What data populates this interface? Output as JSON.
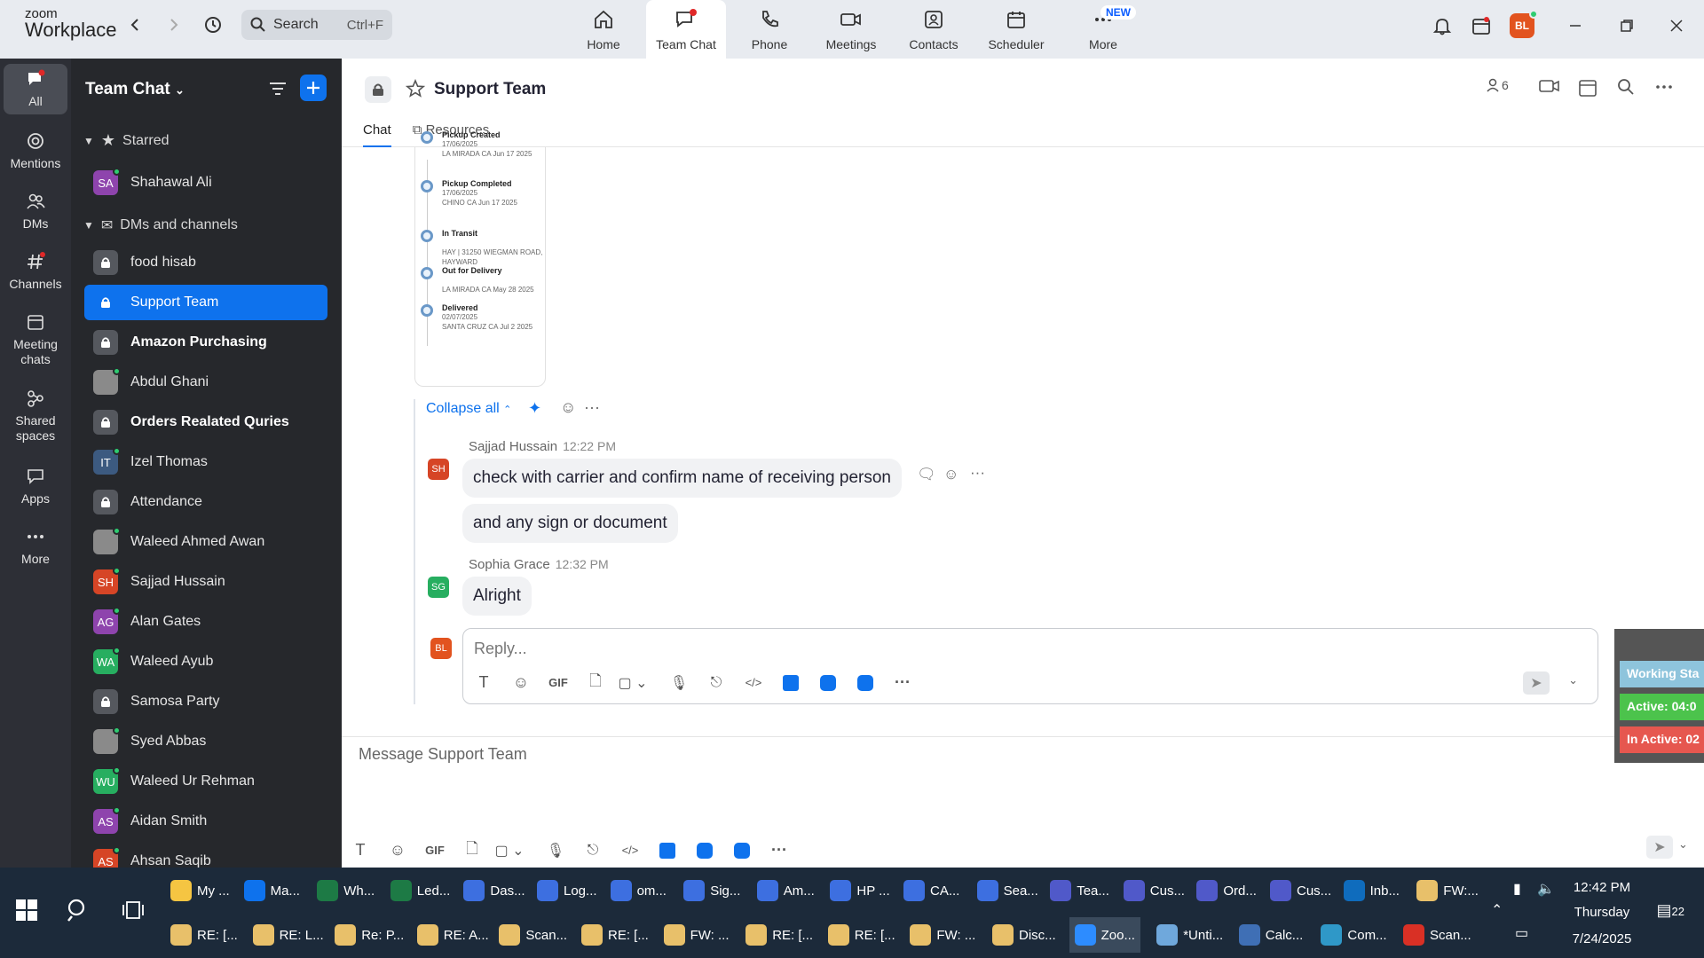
{
  "app": {
    "logo_top": "zoom",
    "logo_bottom": "Workplace"
  },
  "search": {
    "label": "Search",
    "shortcut": "Ctrl+F"
  },
  "top_tabs": [
    {
      "label": "Home"
    },
    {
      "label": "Team Chat"
    },
    {
      "label": "Phone"
    },
    {
      "label": "Meetings"
    },
    {
      "label": "Contacts"
    },
    {
      "label": "Scheduler"
    },
    {
      "label": "More"
    }
  ],
  "new_badge": "NEW",
  "user_initials": "BL",
  "rail": [
    {
      "label": "All"
    },
    {
      "label": "Mentions"
    },
    {
      "label": "DMs"
    },
    {
      "label": "Channels"
    },
    {
      "label": "Meeting\nchats"
    },
    {
      "label": "Shared\nspaces"
    },
    {
      "label": "Apps"
    },
    {
      "label": "More"
    }
  ],
  "sidebar": {
    "title": "Team Chat",
    "starred_label": "Starred",
    "dms_label": "DMs and channels",
    "starred": [
      {
        "name": "Shahawal Ali",
        "initials": "SA",
        "color": "#8e44ad"
      }
    ],
    "items": [
      {
        "name": "food hisab",
        "type": "lock"
      },
      {
        "name": "Support Team",
        "type": "lock"
      },
      {
        "name": "Amazon Purchasing",
        "type": "lock"
      },
      {
        "name": "Abdul Ghani",
        "type": "photo",
        "initials": ""
      },
      {
        "name": "Orders Realated Quries",
        "type": "lock"
      },
      {
        "name": "Izel Thomas",
        "initials": "IT",
        "color": "#3c5a80"
      },
      {
        "name": "Attendance",
        "type": "lock"
      },
      {
        "name": "Waleed Ahmed Awan",
        "type": "photo",
        "initials": ""
      },
      {
        "name": "Sajjad Hussain",
        "initials": "SH",
        "color": "#d64526"
      },
      {
        "name": "Alan Gates",
        "initials": "AG",
        "color": "#8e44ad"
      },
      {
        "name": "Waleed Ayub",
        "initials": "WA",
        "color": "#27ae60"
      },
      {
        "name": "Samosa Party",
        "type": "lock"
      },
      {
        "name": "Syed Abbas",
        "type": "photo",
        "initials": ""
      },
      {
        "name": "Waleed Ur Rehman",
        "initials": "WU",
        "color": "#27ae60"
      },
      {
        "name": "Aidan Smith",
        "initials": "AS",
        "color": "#8e44ad"
      },
      {
        "name": "Ahsan Saqib",
        "initials": "AS",
        "color": "#d64526"
      }
    ]
  },
  "chat": {
    "title": "Support Team",
    "member_count": "6",
    "tabs": {
      "chat": "Chat",
      "resources": "Resources"
    },
    "tracking": [
      {
        "title": "Pickup Created",
        "date": "17/06/2025",
        "loc": "LA MIRADA CA Jun 17 2025"
      },
      {
        "title": "Pickup Completed",
        "date": "17/06/2025",
        "loc": "CHINO CA Jun 17 2025"
      },
      {
        "title": "In Transit",
        "date": "",
        "loc": "HAY | 31250 WIEGMAN ROAD, HAYWARD"
      },
      {
        "title": "Out for Delivery",
        "date": "",
        "loc": "LA MIRADA CA May 28 2025"
      },
      {
        "title": "Delivered",
        "date": "02/07/2025",
        "loc": "SANTA CRUZ CA Jul 2 2025"
      }
    ],
    "collapse_all": "Collapse all",
    "messages": [
      {
        "sender": "Sajjad Hussain",
        "initials": "SH",
        "time": "12:22 PM",
        "lines": [
          "check with carrier and confirm name of receiving person",
          "and any sign or document"
        ]
      },
      {
        "sender": "Sophia Grace",
        "initials": "SG",
        "time": "12:32 PM",
        "lines": [
          "Alright"
        ]
      }
    ],
    "reply_placeholder": "Reply...",
    "composer_placeholder": "Message Support Team"
  },
  "overlay": {
    "r1": "Working Sta",
    "r2": "Active: 04:0",
    "r3": "In Active: 02"
  },
  "taskbar": {
    "row1": [
      "My ...",
      "Ma...",
      "Wh...",
      "Led...",
      "Das...",
      "Log...",
      "om...",
      "Sig...",
      "Am...",
      "HP ...",
      "CA...",
      "Sea...",
      "Tea...",
      "Cus...",
      "Ord...",
      "Cus...",
      "Inb...",
      "FW:..."
    ],
    "row2": [
      "RE: [...",
      "RE: L...",
      "Re: P...",
      "RE: A...",
      "Scan...",
      "RE: [...",
      "FW: ...",
      "RE: [...",
      "RE: [...",
      "FW: ...",
      "Disc...",
      "Zoo...",
      "*Unti...",
      "Calc...",
      "Com...",
      "Scan..."
    ],
    "time": "12:42 PM",
    "day": "Thursday",
    "date": "7/24/2025",
    "notif": "22"
  }
}
